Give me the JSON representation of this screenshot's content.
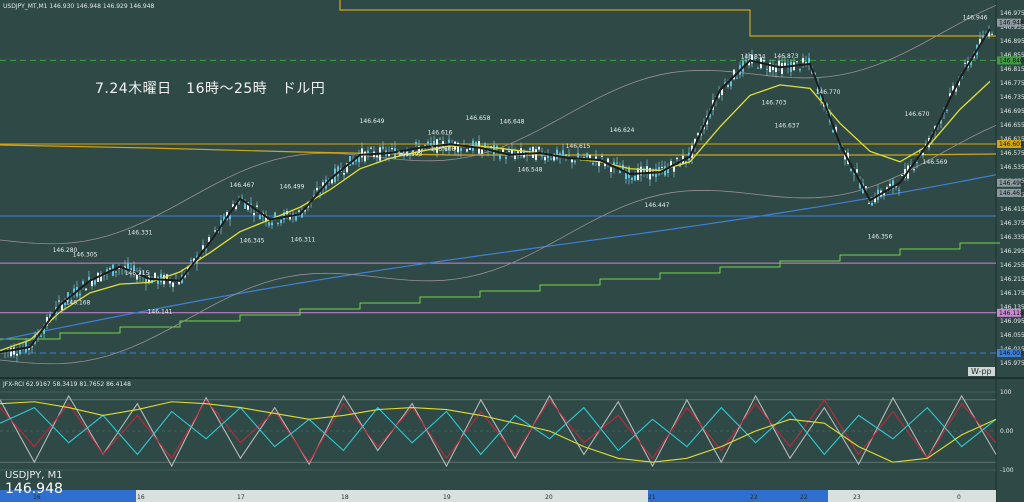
{
  "header": {
    "symbol_line": "USDJPY_MT,M1  146.930 146.948 146.929 146.948",
    "indicator_line": "JFX-RCI 62.9167 58.3419 81.7652 86.4148"
  },
  "annotation": {
    "title": "7.24木曜日　16時～25時　ドル円"
  },
  "footer": {
    "symbol": "USDJPY, M1",
    "last_price": "146.948",
    "wpp_label": "W-pp"
  },
  "chart_data": [
    {
      "type": "line",
      "title": "USDJPY_MT,M1",
      "ylim": [
        145.94,
        146.99
      ],
      "price_axis_ticks": [
        "146.975",
        "146.935",
        "146.895",
        "146.855",
        "146.815",
        "146.775",
        "146.735",
        "146.695",
        "146.655",
        "146.615",
        "146.575",
        "146.535",
        "146.495",
        "146.455",
        "146.415",
        "146.375",
        "146.335",
        "146.295",
        "146.255",
        "146.215",
        "146.175",
        "146.135",
        "146.095",
        "146.055",
        "146.015",
        "145.975"
      ],
      "price_axis_tags": [
        {
          "label": "146.948",
          "value": 146.948,
          "color": "#8a9aa0"
        },
        {
          "label": "146.840",
          "value": 146.84,
          "color": "#3ea33e"
        },
        {
          "label": "146.601",
          "value": 146.601,
          "color": "#d4a514"
        },
        {
          "label": "146.490",
          "value": 146.49,
          "color": "#8a9aa0"
        },
        {
          "label": "146.461",
          "value": 146.461,
          "color": "#8a9aa0"
        },
        {
          "label": "146.118",
          "value": 146.118,
          "color": "#c88ad2"
        },
        {
          "label": "146.003",
          "value": 146.003,
          "color": "#3f7fd6"
        }
      ],
      "horizontal_levels": [
        {
          "value": 146.84,
          "color": "#3ea33e",
          "style": "dashed"
        },
        {
          "value": 146.601,
          "color": "#d4a514",
          "style": "solid"
        },
        {
          "value": 146.395,
          "color": "#3f7fd6",
          "style": "solid"
        },
        {
          "value": 146.26,
          "color": "#d97cd1",
          "style": "solid"
        },
        {
          "value": 146.118,
          "color": "#c88ad2",
          "style": "solid"
        },
        {
          "value": 146.003,
          "color": "#3f7fd6",
          "style": "dashed"
        }
      ],
      "time_axis_labels": [
        "16",
        "16",
        "17",
        "18",
        "19",
        "20",
        "21",
        "22",
        "22",
        "23",
        "0"
      ],
      "price_labels": [
        "146.280",
        "146.305",
        "146.331",
        "146.168",
        "146.215",
        "146.141",
        "146.467",
        "146.345",
        "146.311",
        "146.499",
        "146.649",
        "146.593",
        "146.616",
        "146.606",
        "146.658",
        "146.548",
        "146.648",
        "146.615",
        "146.624",
        "146.447",
        "146.834",
        "146.873",
        "146.703",
        "146.770",
        "146.637",
        "146.356",
        "146.670",
        "146.569",
        "146.946"
      ],
      "series": [
        {
          "color": "#1c1c1c",
          "x": [
            0,
            30,
            60,
            90,
            120,
            150,
            180,
            210,
            240,
            270,
            300,
            330,
            360,
            390,
            420,
            450,
            480,
            510,
            540,
            570,
            600,
            630,
            660,
            690,
            720,
            750,
            780,
            810,
            840,
            870,
            900,
            930,
            960,
            990
          ],
          "values": [
            146.005,
            146.02,
            146.14,
            146.21,
            146.25,
            146.215,
            146.21,
            146.32,
            146.445,
            146.385,
            146.4,
            146.5,
            146.57,
            146.575,
            146.59,
            146.6,
            146.59,
            146.57,
            146.575,
            146.56,
            146.555,
            146.515,
            146.52,
            146.565,
            146.755,
            146.84,
            146.82,
            146.83,
            146.6,
            146.44,
            146.49,
            146.61,
            146.79,
            146.93
          ]
        },
        {
          "color": "#e0de38",
          "x": [
            0,
            30,
            60,
            90,
            120,
            150,
            180,
            210,
            240,
            270,
            300,
            330,
            360,
            390,
            420,
            450,
            480,
            510,
            540,
            570,
            600,
            630,
            660,
            690,
            720,
            750,
            780,
            810,
            840,
            870,
            900,
            930,
            960,
            990
          ],
          "values": [
            146.01,
            146.04,
            146.12,
            146.175,
            146.2,
            146.205,
            146.235,
            146.29,
            146.35,
            146.385,
            146.42,
            146.47,
            146.53,
            146.56,
            146.58,
            146.595,
            146.595,
            146.585,
            146.575,
            146.56,
            146.55,
            146.53,
            146.525,
            146.55,
            146.65,
            146.74,
            146.77,
            146.76,
            146.66,
            146.58,
            146.55,
            146.6,
            146.7,
            146.78
          ]
        }
      ]
    },
    {
      "type": "line",
      "title": "JFX-RCI",
      "ylim": [
        -100,
        100
      ],
      "scale_labels": [
        "100",
        "0.00",
        "-100"
      ],
      "series": [
        {
          "color": "#b8b8b8",
          "values": [
            80,
            -80,
            90,
            -60,
            70,
            -90,
            85,
            -70,
            60,
            -85,
            90,
            -50,
            70,
            -90,
            80,
            -70,
            90,
            -60,
            75,
            -90,
            80,
            -80,
            90,
            -70,
            60,
            -85,
            85,
            -70,
            90,
            -60
          ]
        },
        {
          "color": "#c0283c",
          "values": [
            60,
            -40,
            70,
            -60,
            40,
            -70,
            80,
            -30,
            50,
            -80,
            70,
            -40,
            60,
            -70,
            50,
            -60,
            80,
            -30,
            40,
            -70,
            60,
            -50,
            70,
            -40,
            80,
            -60,
            50,
            -70,
            70,
            -30
          ]
        },
        {
          "color": "#30c8d4",
          "values": [
            20,
            60,
            -30,
            40,
            -60,
            50,
            -20,
            60,
            -40,
            30,
            -50,
            60,
            -30,
            50,
            -60,
            40,
            -20,
            60,
            -50,
            30,
            -40,
            60,
            -30,
            50,
            -60,
            40,
            -20,
            60,
            -40,
            30
          ]
        },
        {
          "color": "#e3dc2e",
          "values": [
            70,
            75,
            60,
            40,
            55,
            75,
            70,
            60,
            45,
            30,
            40,
            55,
            60,
            55,
            40,
            20,
            0,
            -40,
            -70,
            -80,
            -70,
            -40,
            0,
            30,
            20,
            -40,
            -80,
            -70,
            -10,
            30
          ]
        }
      ]
    }
  ]
}
